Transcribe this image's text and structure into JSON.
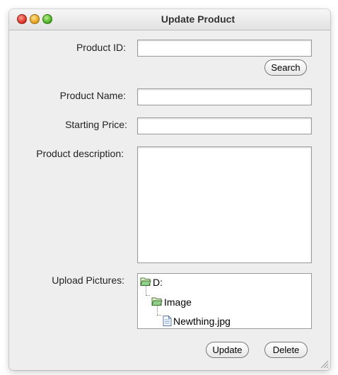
{
  "window": {
    "title": "Update Product"
  },
  "form": {
    "product_id_label": "Product ID:",
    "product_id_value": "",
    "search_label": "Search",
    "product_name_label": "Product Name:",
    "product_name_value": "",
    "starting_price_label": "Starting Price:",
    "starting_price_value": "",
    "description_label": "Product description:",
    "description_value": "",
    "upload_label": "Upload Pictures:"
  },
  "tree": {
    "root": {
      "label": "D:",
      "icon": "folder-open-icon"
    },
    "child": {
      "label": "Image",
      "icon": "folder-open-icon"
    },
    "file": {
      "label": "Newthing.jpg",
      "icon": "file-icon"
    }
  },
  "actions": {
    "update_label": "Update",
    "delete_label": "Delete"
  }
}
